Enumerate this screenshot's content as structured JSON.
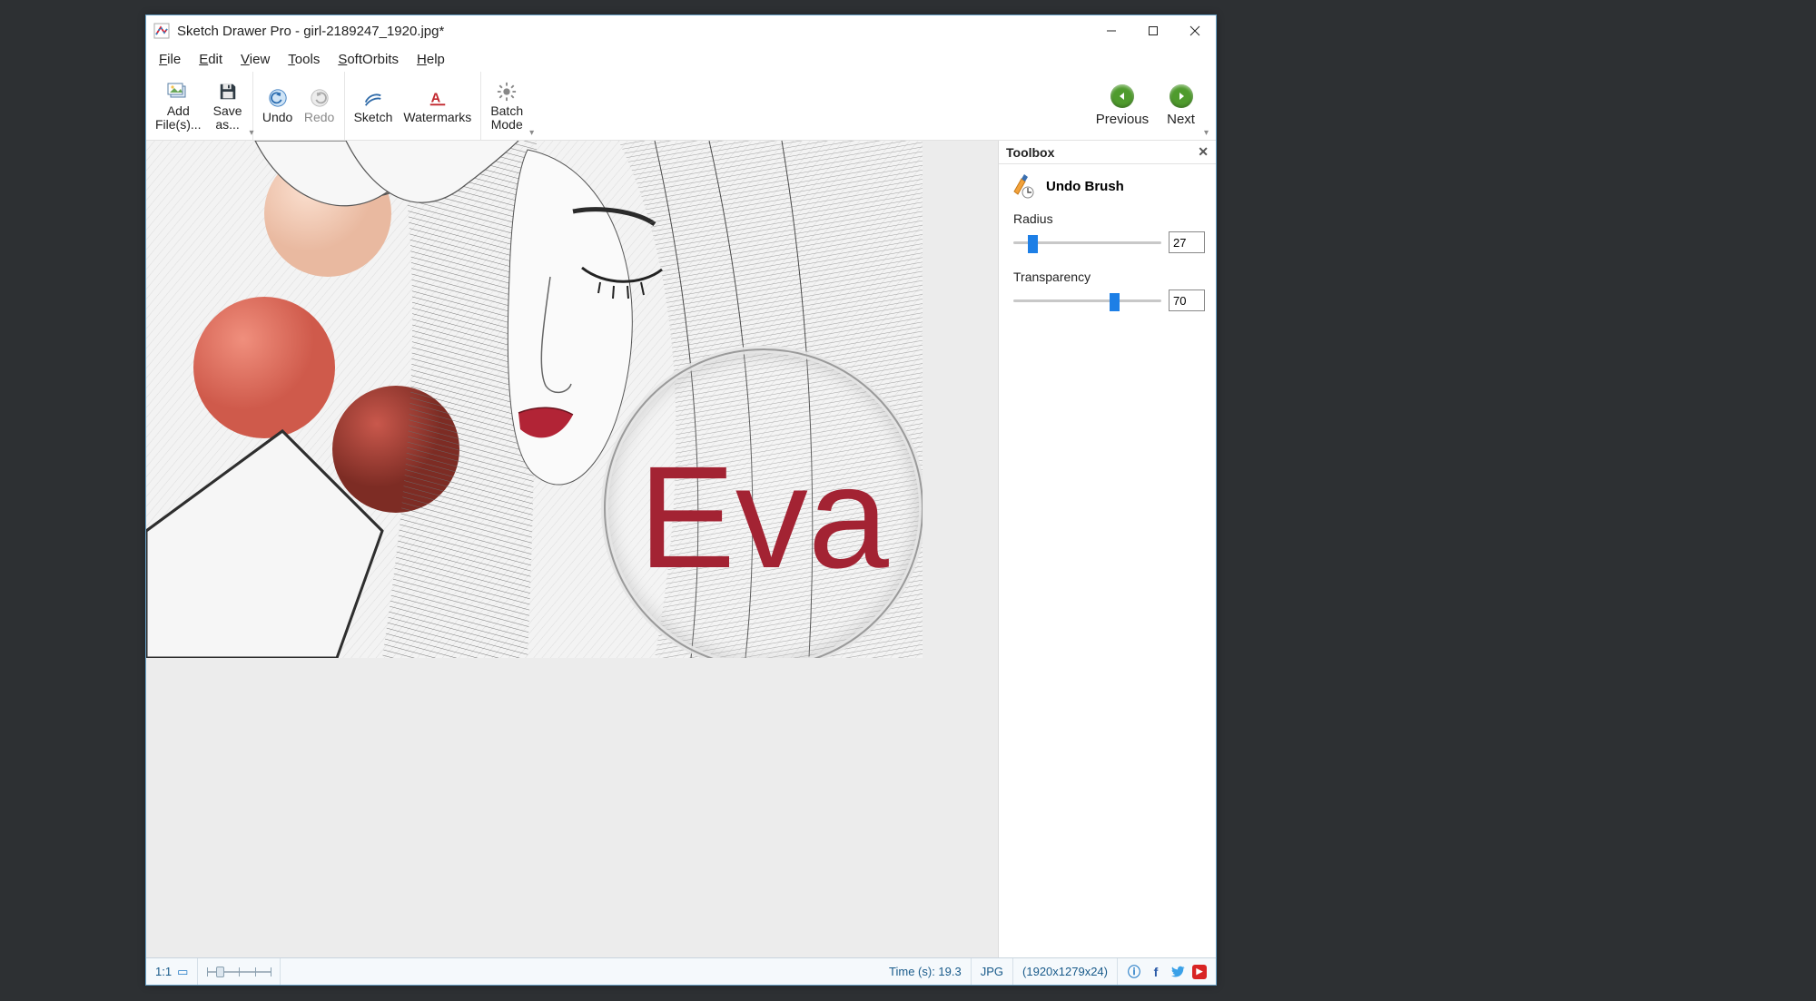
{
  "title": "Sketch Drawer Pro - girl-2189247_1920.jpg*",
  "menu": [
    "File",
    "Edit",
    "View",
    "Tools",
    "SoftOrbits",
    "Help"
  ],
  "toolbar": {
    "add_files": "Add",
    "add_files2": "File(s)...",
    "save_as": "Save",
    "save_as2": "as...",
    "undo": "Undo",
    "redo": "Redo",
    "sketch": "Sketch",
    "watermarks": "Watermarks",
    "batch": "Batch",
    "batch2": "Mode",
    "previous": "Previous",
    "next": "Next"
  },
  "canvas": {
    "watermark_text": "Eva"
  },
  "toolbox": {
    "title": "Toolbox",
    "tool_name": "Undo Brush",
    "radius_label": "Radius",
    "radius_value": "27",
    "radius_percent": 13,
    "transparency_label": "Transparency",
    "transparency_value": "70",
    "transparency_percent": 68
  },
  "statusbar": {
    "zoom_label": "1:1",
    "time": "Time (s): 19.3",
    "format": "JPG",
    "dimensions": "(1920x1279x24)"
  }
}
